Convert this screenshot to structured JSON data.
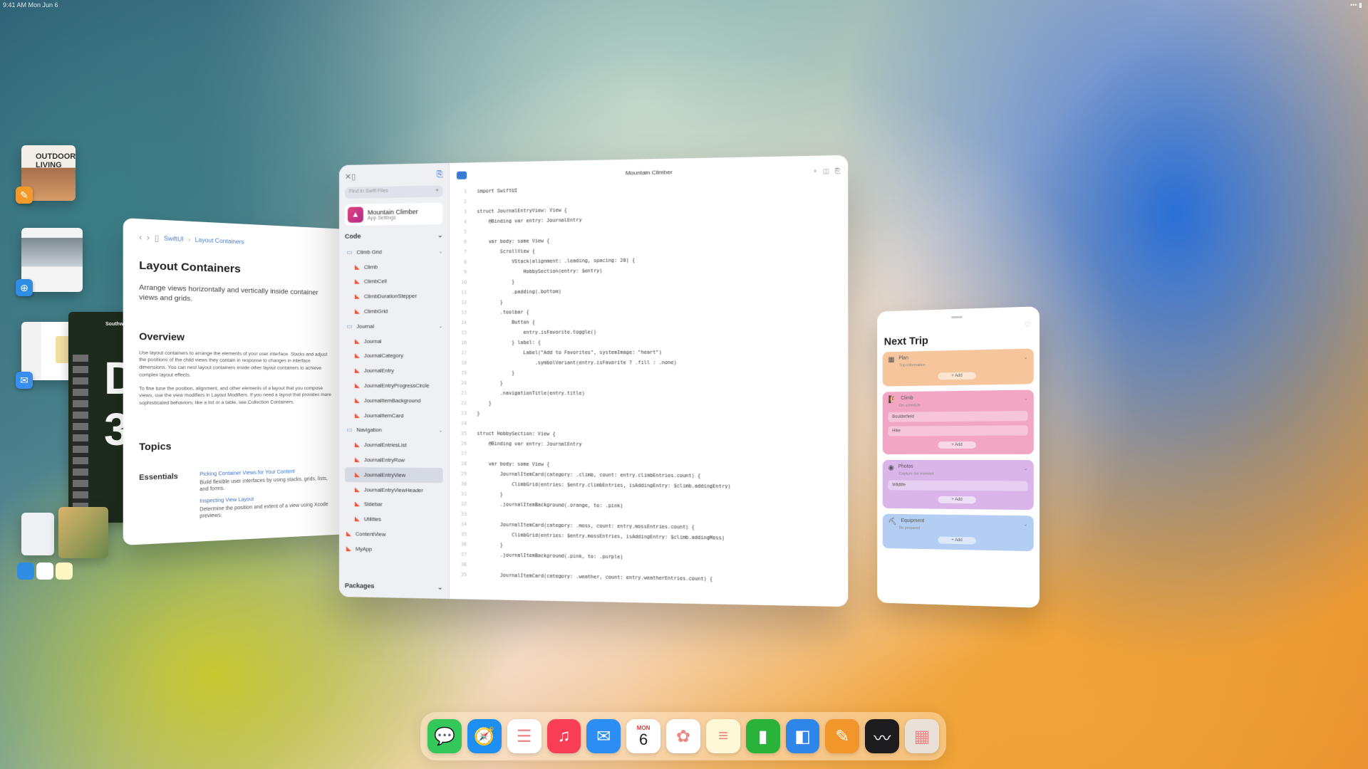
{
  "status": {
    "time": "9:41 AM  Mon Jun 6"
  },
  "stage": {
    "thumbs": [
      {
        "title": "OUTDOOR LIVING",
        "badge": "pages-icon",
        "color": "#f19a2a"
      },
      {
        "title": "",
        "badge": "safari-icon",
        "color": "#2f8de4"
      },
      {
        "title": "",
        "badge": "mail-icon",
        "color": "#3a8ef0"
      },
      {
        "title": "Southwest",
        "big": "D",
        "big2": "3"
      }
    ]
  },
  "doc": {
    "crumbs": [
      "SwiftUI",
      "Layout Containers"
    ],
    "title": "Layout Containers",
    "subtitle": "Arrange views horizontally and vertically inside container views and grids.",
    "overview_heading": "Overview",
    "overview_p1": "Use layout containers to arrange the elements of your user interface. Stacks and adjust the positions of the child views they contain in response to changes in interface dimensions. You can nest layout containers inside other layout containers to achieve complex layout effects.",
    "overview_p2": "To fine tune the position, alignment, and other elements of a layout that you compose views, use the view modifiers in Layout Modifiers. If you need a layout that provides more sophisticated behaviors, like a list or a table, see Collection Containers.",
    "topics_heading": "Topics",
    "essentials_label": "Essentials",
    "essentials": [
      {
        "link": "Picking Container Views for Your Content",
        "desc": "Build flexible user interfaces by using stacks, grids, lists, and forms."
      },
      {
        "link": "Inspecting View Layout",
        "desc": "Determine the position and extent of a view using Xcode previews."
      }
    ]
  },
  "xcode": {
    "search_placeholder": "Find in Swift Files",
    "project_name": "Mountain Climber",
    "project_sub": "App Settings",
    "window_title": "Mountain Climber",
    "code_section": "Code",
    "packages_section": "Packages",
    "tree": [
      {
        "label": "Climb Grid",
        "type": "folder",
        "level": 1
      },
      {
        "label": "Climb",
        "type": "swift",
        "level": 2
      },
      {
        "label": "ClimbCell",
        "type": "swift",
        "level": 2
      },
      {
        "label": "ClimbDurationStepper",
        "type": "swift",
        "level": 2
      },
      {
        "label": "ClimbGrid",
        "type": "swift",
        "level": 2
      },
      {
        "label": "Journal",
        "type": "folder",
        "level": 1
      },
      {
        "label": "Journal",
        "type": "swift",
        "level": 2
      },
      {
        "label": "JournalCategory",
        "type": "swift",
        "level": 2
      },
      {
        "label": "JournalEntry",
        "type": "swift",
        "level": 2
      },
      {
        "label": "JournalEntryProgressCircle",
        "type": "swift",
        "level": 2
      },
      {
        "label": "JournalItemBackground",
        "type": "swift",
        "level": 2
      },
      {
        "label": "JournalItemCard",
        "type": "swift",
        "level": 2
      },
      {
        "label": "Navigation",
        "type": "folder",
        "level": 1
      },
      {
        "label": "JournalEntriesList",
        "type": "swift",
        "level": 2
      },
      {
        "label": "JournalEntryRow",
        "type": "swift",
        "level": 2
      },
      {
        "label": "JournalEntryView",
        "type": "swift",
        "level": 2,
        "selected": true
      },
      {
        "label": "JournalEntryViewHeader",
        "type": "swift",
        "level": 2
      },
      {
        "label": "Sidebar",
        "type": "swift",
        "level": 2
      },
      {
        "label": "Utilities",
        "type": "swift",
        "level": 2
      },
      {
        "label": "ContentView",
        "type": "swift",
        "level": 1
      },
      {
        "label": "MyApp",
        "type": "swift",
        "level": 1
      }
    ],
    "code_lines": [
      "import SwiftUI",
      "",
      "struct JournalEntryView: View {",
      "    @Binding var entry: JournalEntry",
      "",
      "    var body: some View {",
      "        ScrollView {",
      "            VStack(alignment: .leading, spacing: 20) {",
      "                HobbySection(entry: $entry)",
      "            }",
      "            .padding(.bottom)",
      "        }",
      "        .toolbar {",
      "            Button {",
      "                entry.isFavorite.toggle()",
      "            } label: {",
      "                Label(\"Add to Favorites\", systemImage: \"heart\")",
      "                    .symbolVariant(entry.isFavorite ? .fill : .none)",
      "            }",
      "        }",
      "        .navigationTitle(entry.title)",
      "    }",
      "}",
      "",
      "struct HobbySection: View {",
      "    @Binding var entry: JournalEntry",
      "",
      "    var body: some View {",
      "        JournalItemCard(category: .climb, count: entry.climbEntries.count) {",
      "            ClimbGrid(entries: $entry.climbEntries, isAddingEntry: $climb.addingEntry)",
      "        }",
      "        .journalItemBackground(.orange, to: .pink)",
      "",
      "        JournalItemCard(category: .moss, count: entry.mossEntries.count) {",
      "            ClimbGrid(entries: $entry.mossEntries, isAddingEntry: $climb.addingMoss)",
      "        }",
      "        .journalItemBackground(.pink, to: .purple)",
      "",
      "        JournalItemCard(category: .weather, count: entry.weatherEntries.count) {"
    ]
  },
  "trip": {
    "title": "Next Trip",
    "cards": [
      {
        "title": "Plan",
        "sub": "Trip information",
        "color": "#f7c59b",
        "rows": [],
        "add": "+ Add"
      },
      {
        "title": "Climb",
        "sub": "On schedule",
        "color": "#f3a6c3",
        "rows": [
          "Boulderfield",
          "Hike"
        ],
        "add": "+ Add"
      },
      {
        "title": "Photos",
        "sub": "Capture the moment",
        "color": "#d9b5ea",
        "rows": [
          "Wildlife"
        ],
        "add": "+ Add"
      },
      {
        "title": "Equipment",
        "sub": "Be prepared",
        "color": "#b4cdf3",
        "rows": [],
        "add": "+ Add"
      }
    ]
  },
  "dock": {
    "apps": [
      {
        "name": "messages-icon",
        "glyph": "💬",
        "color": "#34c759"
      },
      {
        "name": "safari-icon",
        "glyph": "🧭",
        "color": "#1f8ef1"
      },
      {
        "name": "reminders-icon",
        "glyph": "☰",
        "color": "#ffffff"
      },
      {
        "name": "music-icon",
        "glyph": "♫",
        "color": "#fa3e56"
      },
      {
        "name": "mail-icon",
        "glyph": "✉",
        "color": "#2c8df5"
      },
      {
        "name": "calendar-icon",
        "glyph": "",
        "color": "#ffffff",
        "mon": "MON",
        "day": "6"
      },
      {
        "name": "photos-icon",
        "glyph": "✿",
        "color": "#ffffff"
      },
      {
        "name": "notes-icon",
        "glyph": "≡",
        "color": "#fff8d6"
      },
      {
        "name": "numbers-icon",
        "glyph": "▮",
        "color": "#29b33a"
      },
      {
        "name": "keynote-icon",
        "glyph": "◧",
        "color": "#2e86e8"
      },
      {
        "name": "pages-icon",
        "glyph": "✎",
        "color": "#f2952a"
      },
      {
        "name": "freeform-icon",
        "glyph": "〰",
        "color": "#1c1c1e"
      },
      {
        "name": "app-library-icon",
        "glyph": "▦",
        "color": "#e9e1d8"
      }
    ]
  }
}
